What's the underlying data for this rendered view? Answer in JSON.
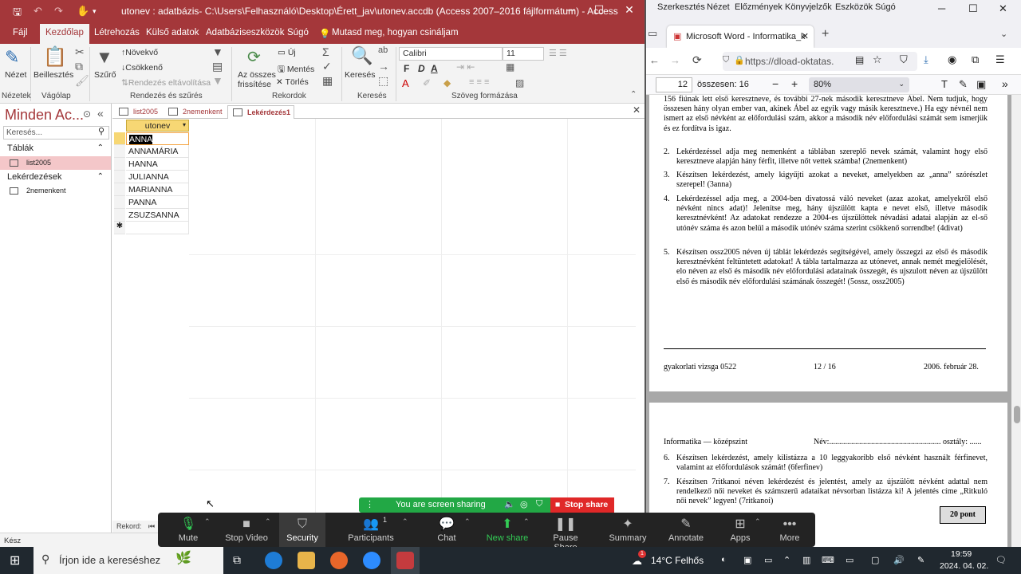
{
  "access": {
    "title": "utonev : adatbázis- C:\\Users\\Felhasználó\\Desktop\\Érett_jav\\utonev.accdb (Access 2007–2016 fájlformátum)  -  Access",
    "ribbon_tabs": [
      "Fájl",
      "Kezdőlap",
      "Létrehozás",
      "Külső adatok",
      "Adatbáziseszközök",
      "Súgó"
    ],
    "tell_me": "Mutasd meg, hogyan csináljam",
    "ribbon": {
      "view": "Nézet",
      "paste": "Beillesztés",
      "filter": "Szűrő",
      "ascending": "Növekvő",
      "descending": "Csökkenő",
      "remove_sort": "Rendezés eltávolítása",
      "refresh_all": "Az összes frissítése",
      "new": "Új",
      "save": "Mentés",
      "delete": "Törlés",
      "find": "Keresés",
      "font_name": "Calibri",
      "font_size": "11",
      "bold": "F",
      "italic": "D",
      "underline": "A",
      "groups": [
        "Nézetek",
        "Vágólap",
        "Rendezés és szűrés",
        "Rekordok",
        "Keresés",
        "Szöveg formázása"
      ]
    },
    "nav": {
      "title": "Minden Ac...",
      "search_placeholder": "Keresés...",
      "tables_header": "Táblák",
      "tables": [
        "list2005"
      ],
      "queries_header": "Lekérdezések",
      "queries": [
        "2nemenkent"
      ]
    },
    "doc_tabs": [
      "list2005",
      "2nemenkent",
      "Lekérdezés1"
    ],
    "datasheet": {
      "column": "utonev",
      "rows": [
        "ANNA",
        "ANNAMÁRIA",
        "HANNA",
        "JULIANNA",
        "MARIANNA",
        "PANNA",
        "ZSUZSANNA"
      ],
      "new_row_marker": "✱"
    },
    "record_label": "Rekord:",
    "status": "Kész"
  },
  "browser": {
    "menu": [
      "Szerkesztés",
      "Nézet",
      "Előzmények",
      "Könyvjelzők",
      "Eszközök",
      "Súgó"
    ],
    "tab_title": "Microsoft Word - Informatika_k",
    "url": "https://dload-oktatas.",
    "pdf": {
      "page": "12",
      "total": "összesen: 16",
      "zoom": "80%"
    },
    "doc": {
      "intro": "156 fiúnak lett első keresztneve, és további 27-nek második keresztneve Ábel. Nem tudjuk, hogy összesen hány olyan ember van, akinek Ábel az egyik vagy másik keresztneve.) Ha egy névnél nem ismert az első névként az előfordulási szám, akkor a második név előfordulási számát sem ismerjük és ez fordítva is igaz.",
      "item2": "Lekérdezéssel adja meg nemenként a táblában szereplő nevek számát, valamint hogy első keresztneve alapján hány férfit, illetve nőt vettek számba! (2nemenkent)",
      "item3": "Készítsen lekérdezést, amely kigyűjti azokat a neveket, amelyekben az „anna” szórészlet szerepel! (3anna)",
      "item4": "Lekérdezéssel adja meg, a 2004-ben divatossá váló neveket (azaz azokat, amelyekről első névként nincs adat)! Jelenítse meg, hány újszülött kapta e nevet első, illetve második keresztnévként! Az adatokat rendezze a 2004-es újszülöttek névadási adatai alapján az el-ső utónév száma és azon belül a második utónév száma szerint csökkenő sorrendbe! (4divat)",
      "item5": "Készítsen ossz2005 néven új táblát lekérdezés segítségével, amely összegzi az első és második keresztnévként feltüntetett adatokat! A tábla tartalmazza az utónevet, annak nemét megjelölését, elo néven az első és második név előfordulási adatainak összegét, és ujszulott néven az újszülött első és második név előfordulási számának összegét! (5ossz, ossz2005)",
      "footer_left": "gyakorlati vizsga 0522",
      "footer_mid": "12 / 16",
      "footer_right": "2006. február 28.",
      "header_left": "Informatika — középszint",
      "header_right": "Név:........................................................ osztály: ......",
      "item6": "Készítsen lekérdezést, amely kilistázza a 10 leggyakoribb első névként használt férfinevet, valamint az előfordulások számát! (6ferfinev)",
      "item7": "Készítsen 7ritkanoi néven lekérdezést és jelentést, amely az újszülött névként adattal nem rendelkező női neveket és számszerű adataikat névsorban listázza ki! A jelentés címe „Ritkuló női nevek” legyen! (7ritkanoi)",
      "points": "20 pont"
    }
  },
  "zoom": {
    "sharing": "You are screen sharing",
    "stop_share": "Stop share",
    "buttons": [
      "Mute",
      "Stop Video",
      "Security",
      "Participants",
      "Chat",
      "New share",
      "Pause Share",
      "Summary",
      "Annotate",
      "Apps",
      "More"
    ],
    "participants_count": "1"
  },
  "taskbar": {
    "search_placeholder": "Írjon ide a kereséshez",
    "weather": "14°C Felhős",
    "time": "19:59",
    "date": "2024. 04. 02.",
    "notification_count": "1"
  },
  "colors": {
    "access_red": "#a4373a",
    "zoom_bg": "#232323",
    "share_green": "#22a845",
    "stop_red": "#e02828",
    "taskbar": "#20282f"
  }
}
